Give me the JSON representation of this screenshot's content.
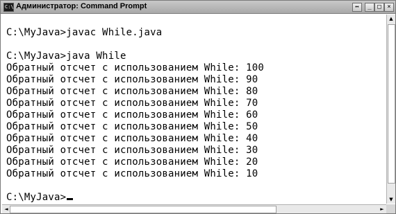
{
  "window": {
    "title": "Администратор: Command Prompt",
    "icon_label": "C:\\",
    "buttons": {
      "move": "↔",
      "minimize": "_",
      "maximize": "□",
      "close": "×"
    }
  },
  "console": {
    "lines": [
      "",
      "C:\\MyJava>javac While.java",
      "",
      "C:\\MyJava>java While",
      "Обратный отсчет с использованием While: 100",
      "Обратный отсчет с использованием While: 90",
      "Обратный отсчет с использованием While: 80",
      "Обратный отсчет с использованием While: 70",
      "Обратный отсчет с использованием While: 60",
      "Обратный отсчет с использованием While: 50",
      "Обратный отсчет с использованием While: 40",
      "Обратный отсчет с использованием While: 30",
      "Обратный отсчет с использованием While: 20",
      "Обратный отсчет с использованием While: 10",
      ""
    ],
    "prompt": "C:\\MyJava>"
  },
  "scrollbars": {
    "up_arrow": "▲",
    "down_arrow": "▼",
    "left_arrow": "◄",
    "right_arrow": "►"
  }
}
